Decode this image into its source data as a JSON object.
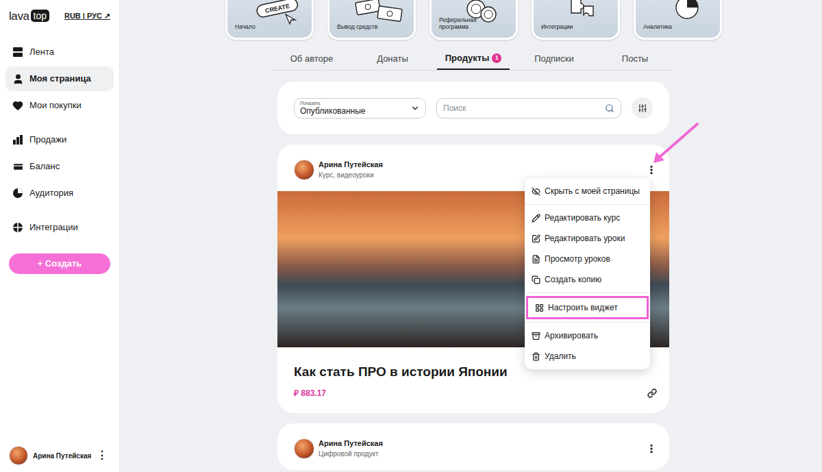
{
  "sidebar": {
    "logo": {
      "left": "lava",
      "right": "top"
    },
    "currency": "RUB | РУС ↗",
    "groups": [
      [
        {
          "label": "Лента",
          "selected": false
        },
        {
          "label": "Моя страница",
          "selected": true
        },
        {
          "label": "Мои покупки",
          "selected": false
        }
      ],
      [
        {
          "label": "Продажи",
          "selected": false
        },
        {
          "label": "Баланс",
          "selected": false
        },
        {
          "label": "Аудитория",
          "selected": false
        }
      ],
      [
        {
          "label": "Интеграции",
          "selected": false
        }
      ]
    ],
    "create_button": "+ Создать",
    "user": {
      "name": "Арина Путейская",
      "menu": "⋮"
    }
  },
  "tiles": [
    {
      "label": "Начало",
      "illustration_text": "CREATE"
    },
    {
      "label": "Вывод средств",
      "illustration_text": ""
    },
    {
      "label": "Реферальная программа",
      "illustration_text": ""
    },
    {
      "label": "Интеграции",
      "illustration_text": ""
    },
    {
      "label": "Аналитика",
      "illustration_text": ""
    }
  ],
  "tabs": [
    {
      "label": "Об авторе",
      "selected": false,
      "badge": ""
    },
    {
      "label": "Донаты",
      "selected": false,
      "badge": ""
    },
    {
      "label": "Продукты",
      "selected": true,
      "badge": "1"
    },
    {
      "label": "Подписки",
      "selected": false,
      "badge": ""
    },
    {
      "label": "Посты",
      "selected": false,
      "badge": ""
    }
  ],
  "filter": {
    "show_label": "Показать",
    "show_value": "Опубликованные",
    "search_placeholder": "Поиск"
  },
  "products": [
    {
      "author": "Арина Путейская",
      "type": "Курс, видеоуроки",
      "title": "Как стать ПРО в истории Японии",
      "price": "₽ 883.17",
      "menu_open": true
    },
    {
      "author": "Арина Путейская",
      "type": "Цифровой продукт",
      "title": "",
      "price": "",
      "menu_open": false
    }
  ],
  "product_menu": {
    "groups": [
      [
        {
          "label": "Скрыть с моей страницы",
          "highlighted": false
        }
      ],
      [
        {
          "label": "Редактировать курс",
          "highlighted": false
        },
        {
          "label": "Редактировать уроки",
          "highlighted": false
        },
        {
          "label": "Просмотр уроков",
          "highlighted": false
        },
        {
          "label": "Создать копию",
          "highlighted": false
        }
      ],
      [
        {
          "label": "Настроить виджет",
          "highlighted": true
        }
      ],
      [
        {
          "label": "Архивировать",
          "highlighted": false
        },
        {
          "label": "Удалить",
          "highlighted": false
        }
      ]
    ]
  }
}
